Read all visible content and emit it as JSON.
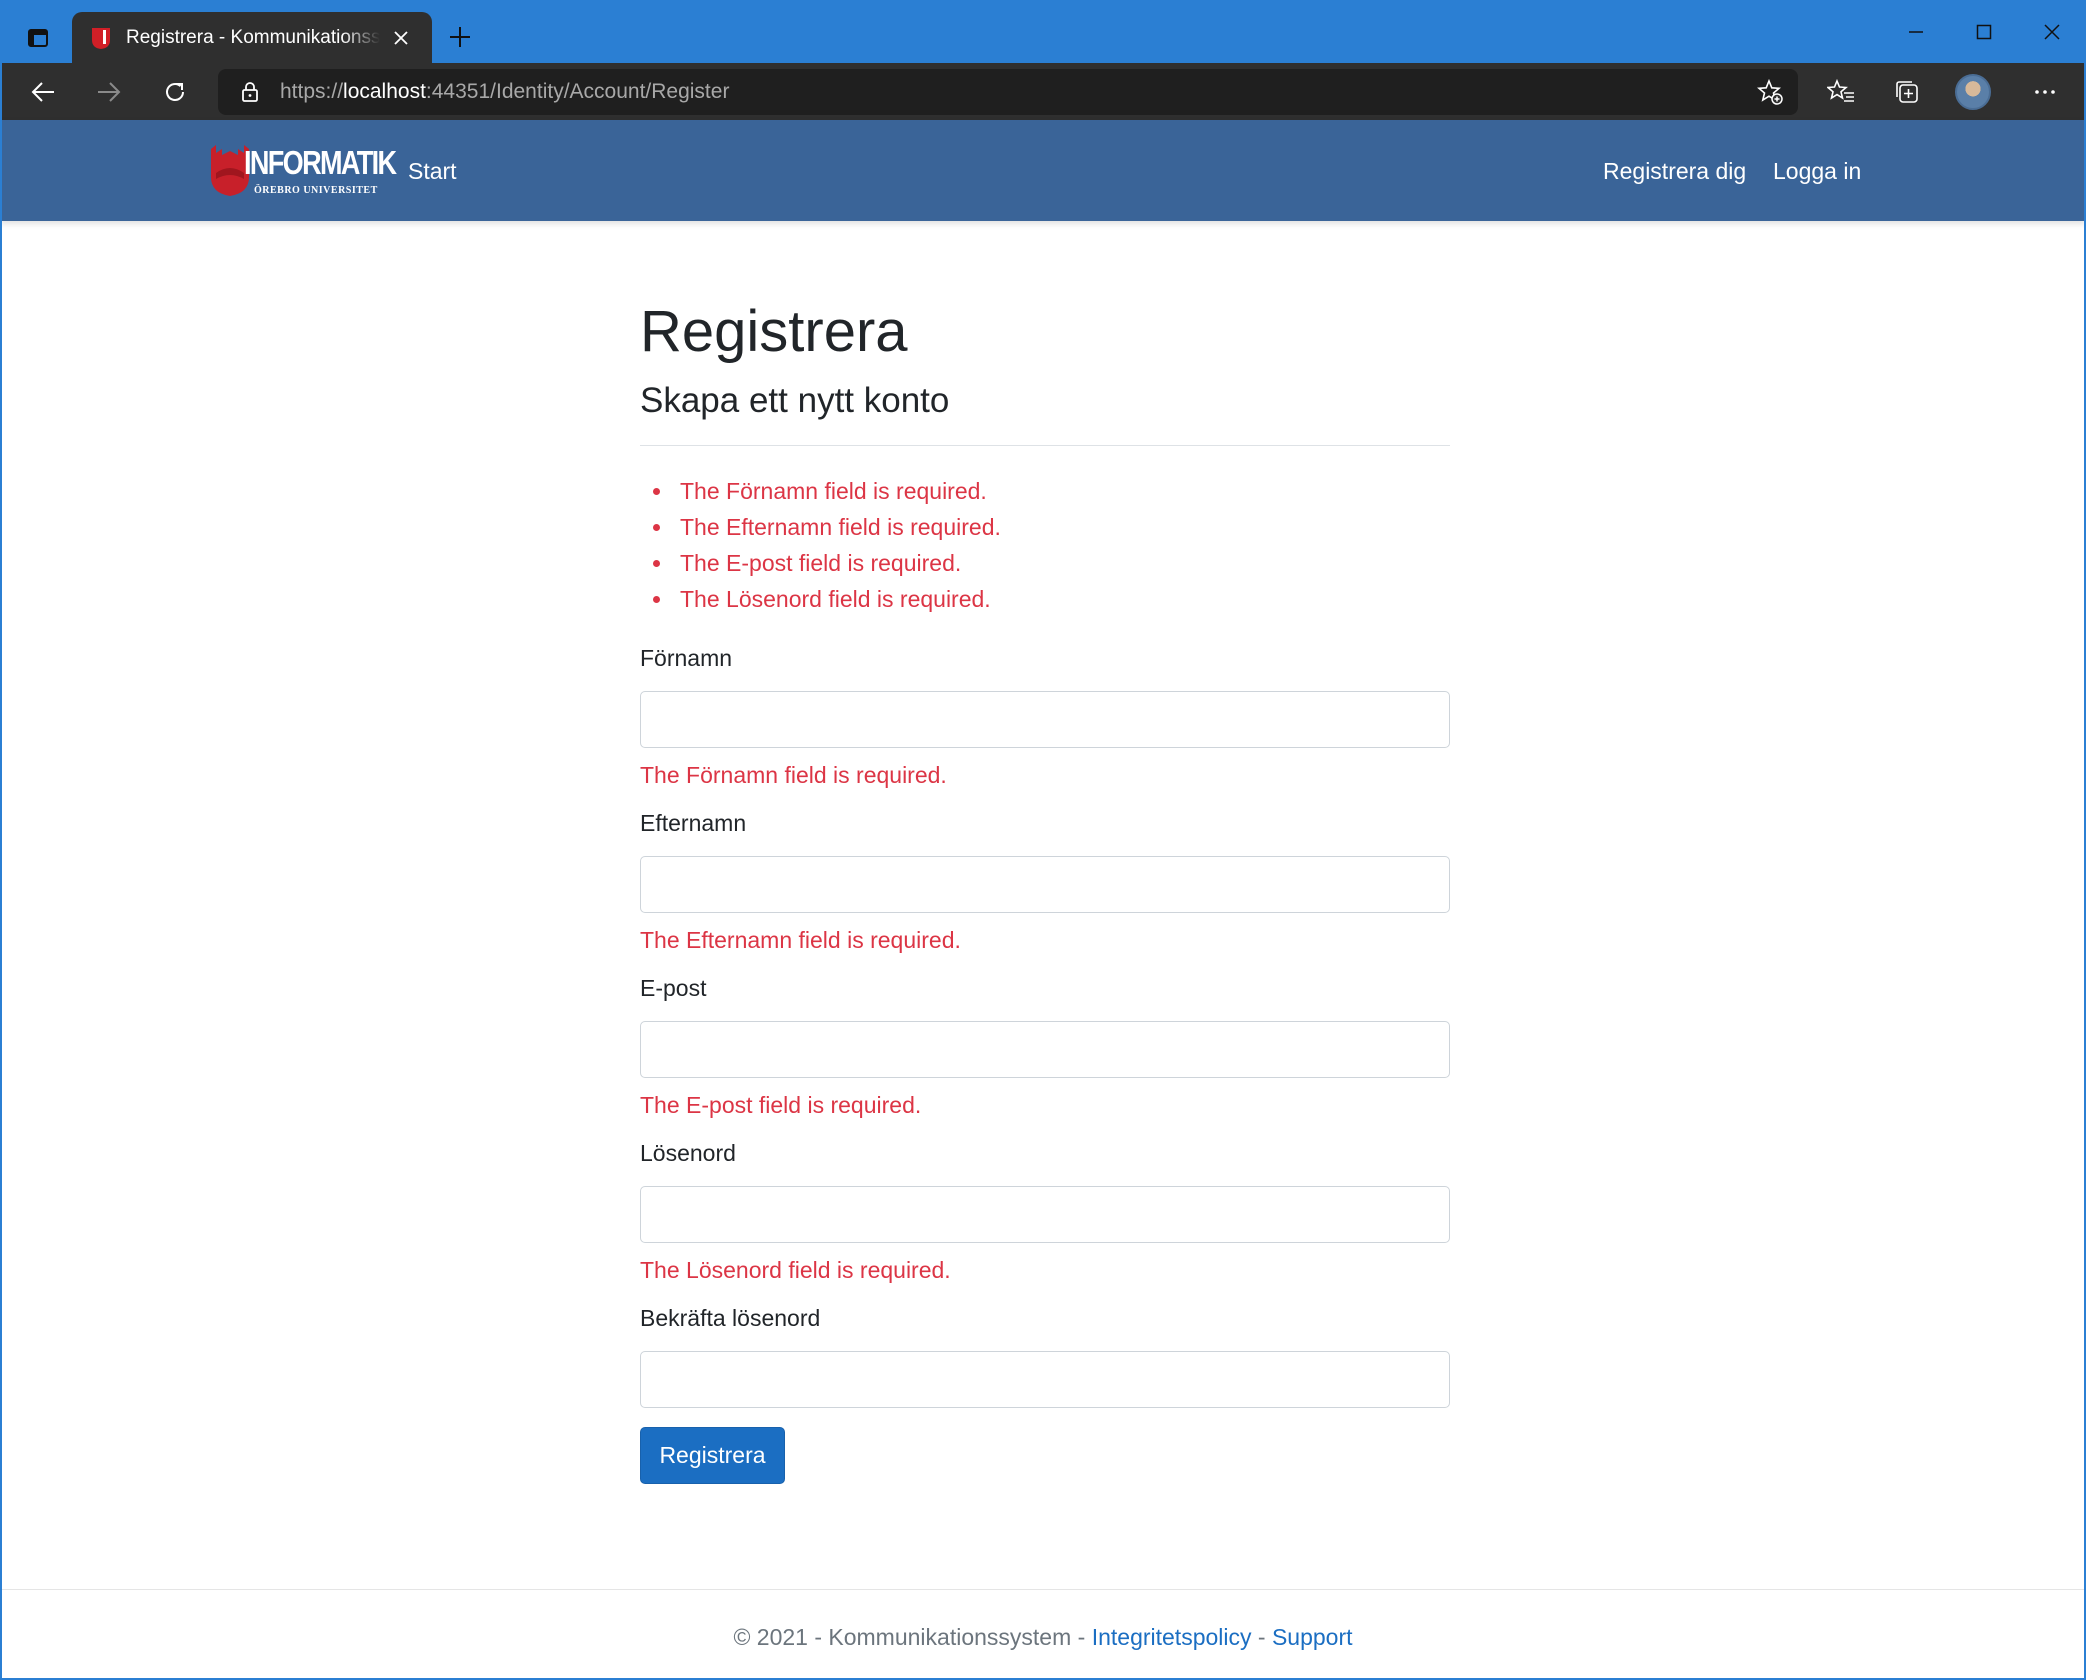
{
  "browser": {
    "tab_title": "Registrera - Kommunikationssystem",
    "url_prefix": "https://",
    "url_host": "localhost",
    "url_rest": ":44351/Identity/Account/Register",
    "accent_color": "#2b7fd3"
  },
  "navbar": {
    "brand_text": "INFORMATIK",
    "brand_subtext": "ÖREBRO UNIVERSITET",
    "links": {
      "start": "Start",
      "register": "Registrera dig",
      "login": "Logga in"
    },
    "background_color": "#3a6498"
  },
  "main": {
    "title": "Registrera",
    "subtitle": "Skapa ett nytt konto",
    "validation_summary": [
      "The Förnamn field is required.",
      "The Efternamn field is required.",
      "The E-post field is required.",
      "The Lösenord field is required."
    ],
    "fields": [
      {
        "label": "Förnamn",
        "value": "",
        "error": "The Förnamn field is required."
      },
      {
        "label": "Efternamn",
        "value": "",
        "error": "The Efternamn field is required."
      },
      {
        "label": "E-post",
        "value": "",
        "error": "The E-post field is required."
      },
      {
        "label": "Lösenord",
        "value": "",
        "error": "The Lösenord field is required."
      },
      {
        "label": "Bekräfta lösenord",
        "value": "",
        "error": ""
      }
    ],
    "submit_label": "Registrera",
    "error_color": "#dc3545",
    "button_color": "#1b6ec2"
  },
  "footer": {
    "copyright": "© 2021 - Kommunikationssystem - ",
    "privacy_link": "Integritetspolicy",
    "separator": " - ",
    "support_link": "Support"
  }
}
